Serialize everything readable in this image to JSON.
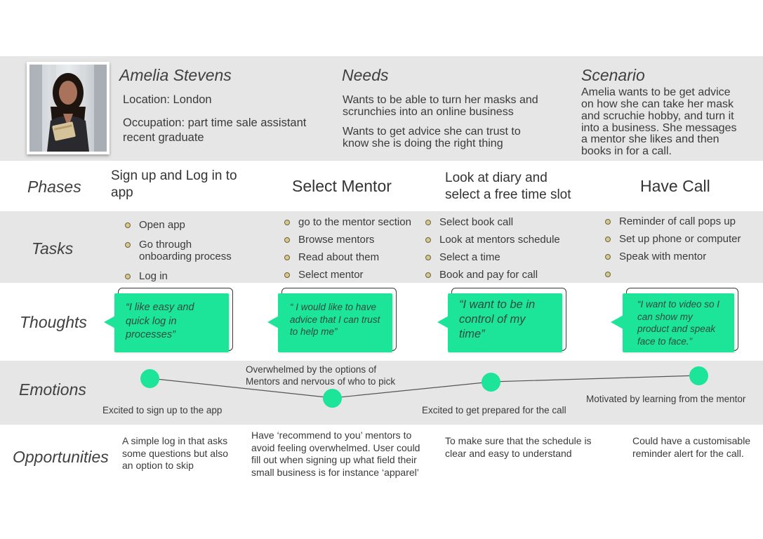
{
  "persona": {
    "name": "Amelia Stevens",
    "location": "Location: London",
    "occupation_line1": "Occupation: part time sale assistant",
    "occupation_line2": "recent graduate"
  },
  "needs": {
    "heading": "Needs",
    "line1": "Wants to be able to turn her masks and",
    "line2": "scrunchies into an online business",
    "line3": "Wants to get advice she can trust to",
    "line4": "know she is doing the right thing"
  },
  "scenario": {
    "heading": "Scenario",
    "lines": [
      "Amelia wants to be get advice",
      "on how she can take her mask",
      "and scruchie hobby, and turn it",
      "into a business. She messages",
      "a mentor she likes and then",
      "books in for a call."
    ]
  },
  "row_labels": {
    "phases": "Phases",
    "tasks": "Tasks",
    "thoughts": "Thoughts",
    "emotions": "Emotions",
    "opportunities": "Opportunities"
  },
  "phases": [
    {
      "line1": "Sign up and Log in to",
      "line2": "app"
    },
    {
      "line1": "Select Mentor"
    },
    {
      "line1": "Look at diary and",
      "line2": "select a free time slot"
    },
    {
      "line1": "Have Call"
    }
  ],
  "tasks": [
    [
      "Open app",
      "Go through onboarding process",
      "Log in"
    ],
    [
      "go to the mentor section",
      "Browse mentors",
      "Read about them",
      "Select mentor"
    ],
    [
      "Select book call",
      "Look at mentors schedule",
      "Select a time",
      "Book and pay for call"
    ],
    [
      "Reminder of call pops up",
      "Set up phone or computer",
      "Speak with mentor",
      ""
    ]
  ],
  "thoughts": [
    {
      "lines": [
        "“I like easy and",
        "quick log in",
        "processes”"
      ]
    },
    {
      "lines": [
        "“ I would like to have",
        "advice that I can trust",
        "to help me”"
      ]
    },
    {
      "lines": [
        "“I want to be in",
        "control of my",
        "time”"
      ]
    },
    {
      "lines": [
        "“I want to video so I",
        "can show my",
        "product and speak",
        "face to face.”"
      ]
    }
  ],
  "emotions": [
    {
      "label": "Excited to sign up to the app",
      "level": 0.9
    },
    {
      "label_line1": "Overwhelmed by the options of",
      "label_line2": "Mentors and nervous of who to pick",
      "level": 0.1
    },
    {
      "label": "Excited to get prepared for the call",
      "level": 0.75
    },
    {
      "label": "Motivated by learning from the mentor",
      "level": 1.0
    }
  ],
  "opportunities": [
    {
      "lines": [
        "A simple log in that asks",
        "some questions but also",
        "an option to skip"
      ]
    },
    {
      "lines": [
        "Have ‘recommend to you’ mentors to",
        "avoid feeling overwhelmed. User could",
        "fill out when signing up what field their",
        "small business is for instance ‘apparel’"
      ]
    },
    {
      "lines": [
        "To make sure that the schedule is",
        "clear and easy to understand"
      ]
    },
    {
      "lines": [
        "Could have a customisable",
        "reminder alert for the call."
      ]
    }
  ],
  "colors": {
    "accent": "#1ce59a",
    "band_gray": "#e6e6e6"
  }
}
